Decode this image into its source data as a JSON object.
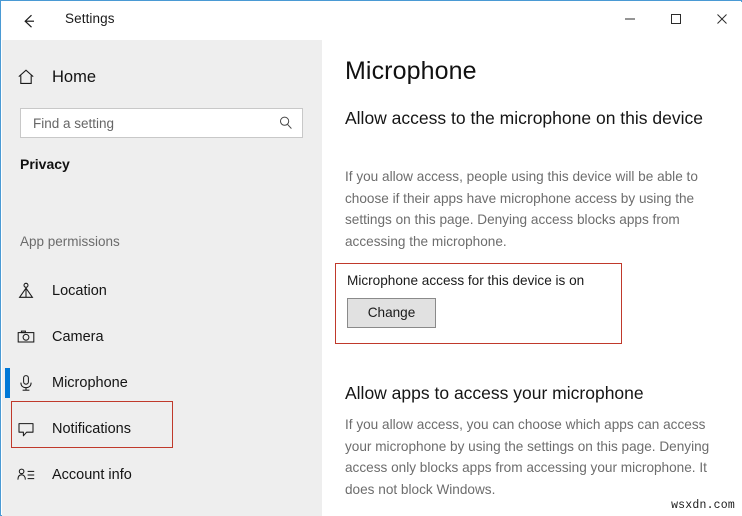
{
  "window": {
    "border_color": "#4a9ad4",
    "titlebar": {
      "back_icon": "arrow-left-icon",
      "title": "Settings",
      "minimize_label": "minimize-icon",
      "maximize_label": "maximize-icon",
      "close_label": "close-icon"
    }
  },
  "sidebar": {
    "background": "#eeeeee",
    "home": {
      "icon": "home-icon",
      "label": "Home"
    },
    "search": {
      "icon": "search-icon",
      "value": "",
      "placeholder": "Find a setting"
    },
    "category_title": "Privacy",
    "group_title": "App permissions",
    "accent_color": "#0078d7",
    "highlight_color": "#c0392b",
    "items": [
      {
        "icon": "location-icon",
        "label": "Location",
        "selected": false
      },
      {
        "icon": "camera-icon",
        "label": "Camera",
        "selected": false
      },
      {
        "icon": "microphone-icon",
        "label": "Microphone",
        "selected": true
      },
      {
        "icon": "notifications-icon",
        "label": "Notifications",
        "selected": false
      },
      {
        "icon": "account-info-icon",
        "label": "Account info",
        "selected": false
      }
    ]
  },
  "main": {
    "page_title": "Microphone",
    "section1": {
      "heading": "Allow access to the microphone on this device",
      "body": "If you allow access, people using this device will be able to choose if their apps have microphone access by using the settings on this page. Denying access blocks apps from accessing the microphone."
    },
    "device_access": {
      "status": "Microphone access for this device is on",
      "button_label": "Change",
      "highlight_color": "#c0392b"
    },
    "section2": {
      "heading": "Allow apps to access your microphone",
      "body": "If you allow access, you can choose which apps can access your microphone by using the settings on this page. Denying access only blocks apps from accessing your microphone. It does not block Windows."
    }
  },
  "watermark": "wsxdn.com"
}
